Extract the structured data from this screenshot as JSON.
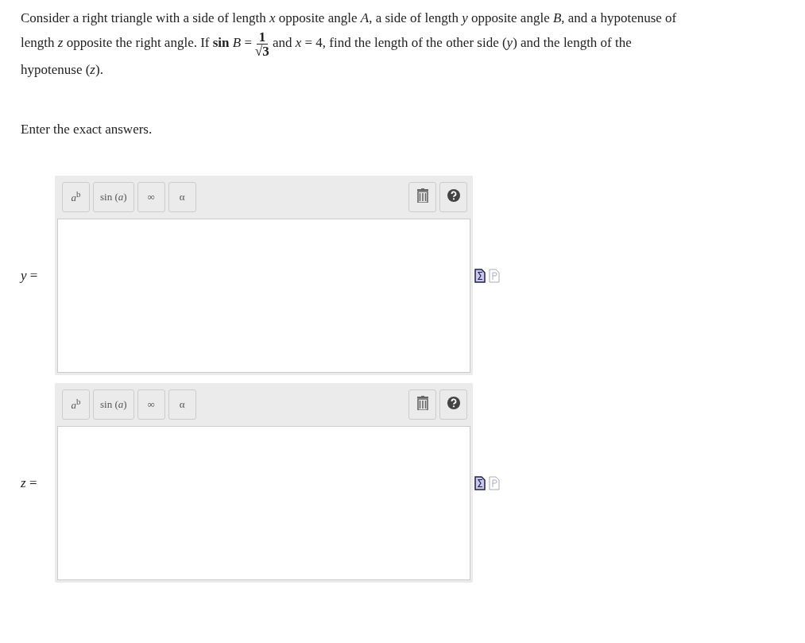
{
  "question": {
    "before": "Consider a right triangle with a side of length *x* opposite angle *A*, a side of length *y* opposite angle *B*, and a hypotenuse of length *z* opposite the right angle. If **sin** *B* =",
    "numerator": "1",
    "denominator": "√3",
    "after": "and *x* = 4, find the length of the other side (*y*) and the length of the hypotenuse (*z*)."
  },
  "instruction": "Enter the exact answers.",
  "answers": [
    {
      "label": "*y* =",
      "toolbar": [
        "*a*$^{b}$",
        "sin (*a*)",
        "∞",
        "α"
      ]
    },
    {
      "label": "*z* =",
      "toolbar": [
        "*a*$^{b}$",
        "sin (*a*)",
        "∞",
        "α"
      ]
    }
  ]
}
